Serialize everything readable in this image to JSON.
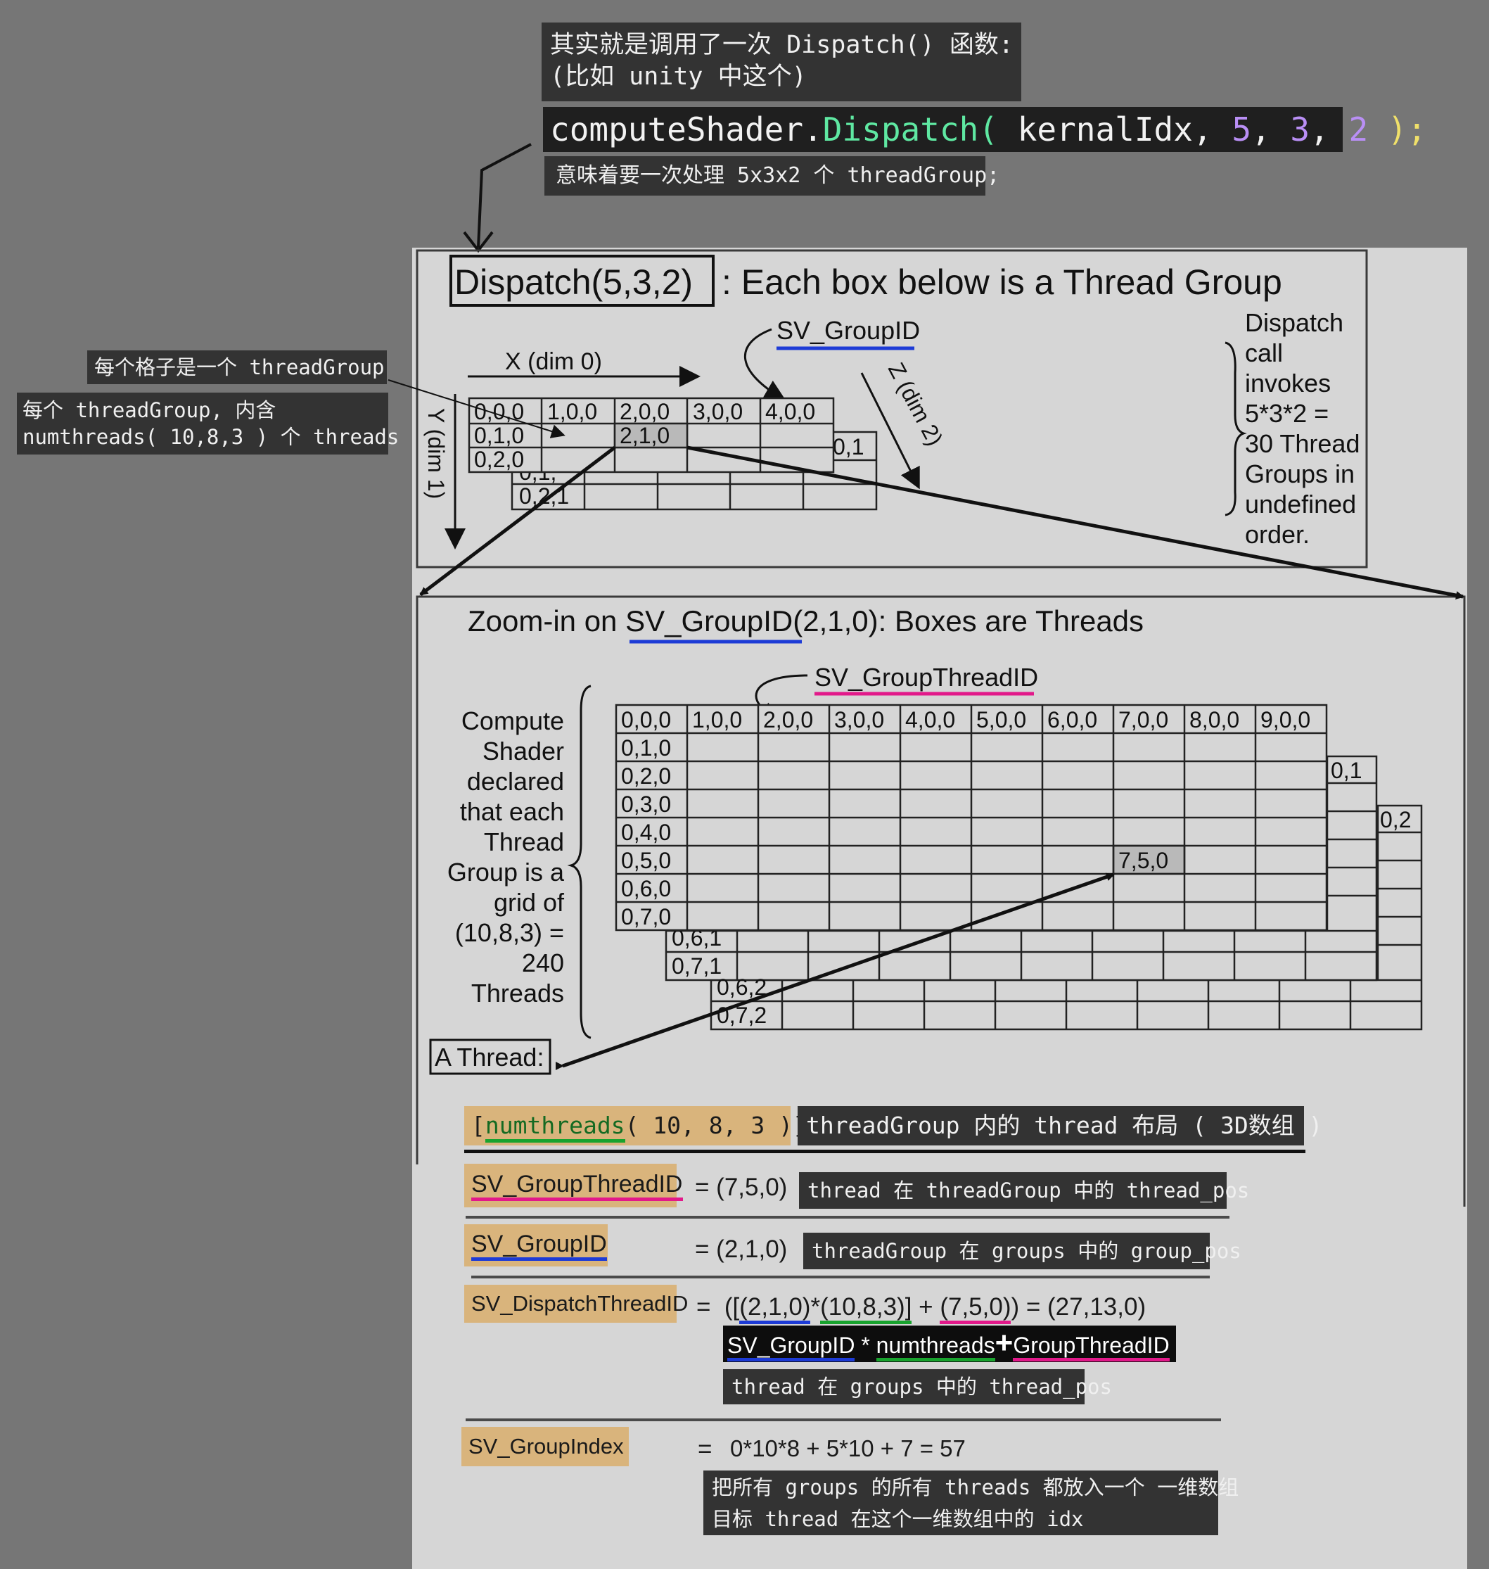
{
  "annotations": {
    "top_note": "其实就是调用了一次 Dispatch() 函数:\n(比如 unity 中这个)",
    "code": {
      "part1": "computeShader",
      "dot": ".",
      "func": "Dispatch(",
      "arg0": " kernalIdx,",
      "n1": " 5",
      "c1": ",",
      "n2": " 3",
      "c2": ",",
      "n3": " 2",
      "close": " );"
    },
    "code_meaning": "意味着要一次处理 5x3x2 个 threadGroup;",
    "grid_cell_note": "每个格子是一个 threadGroup",
    "group_note": "每个 threadGroup, 内含\nnumthreads( 10,8,3 ) 个 threads"
  },
  "diagram_top": {
    "title_box": "Dispatch(5,3,2)",
    "title_rest": ": Each box below is a Thread Group",
    "sv_groupid": "SV_GroupID",
    "x_label": "X (dim 0)",
    "y_label": "Y (dim 1)",
    "z_label": "Z (dim 2)",
    "row0": [
      "0,0,0",
      "1,0,0",
      "2,0,0",
      "3,0,0",
      "4,0,0"
    ],
    "col0": [
      "0,1,0",
      "0,2,0"
    ],
    "cell_210": "2,1,0",
    "layer1_a": "0,1,",
    "layer1_b": "0,2,1",
    "layer1_corner": "0,1",
    "side_text": [
      "Dispatch",
      "call",
      "invokes",
      "5*3*2 =",
      "30 Thread",
      "Groups in",
      "undefined",
      "order."
    ]
  },
  "diagram_zoom": {
    "title_pre": "Zoom-in on ",
    "title_id": "SV_GroupID",
    "title_post": "(2,1,0): Boxes are Threads",
    "sv_groupthreadid": "SV_GroupThreadID",
    "row0": [
      "0,0,0",
      "1,0,0",
      "2,0,0",
      "3,0,0",
      "4,0,0",
      "5,0,0",
      "6,0,0",
      "7,0,0",
      "8,0,0",
      "9,0,0"
    ],
    "col0": [
      "0,1,0",
      "0,2,0",
      "0,3,0",
      "0,4,0",
      "0,5,0",
      "0,6,0",
      "0,7,0"
    ],
    "cell_750": "7,5,0",
    "layer1": [
      "0,6,1",
      "0,7,1"
    ],
    "layer1_corner": "0,1",
    "layer2": [
      "0,6,2",
      "0,7,2"
    ],
    "layer2_corner": "0,2",
    "side_text": [
      "Compute",
      "Shader",
      "declared",
      "that each",
      "Thread",
      "Group is a",
      "grid of",
      "(10,8,3) =",
      "240",
      "Threads"
    ],
    "a_thread": "A Thread:"
  },
  "formulas": {
    "numthreads_open": "[",
    "numthreads_kw": "numthreads",
    "numthreads_args": "( 10, 8, 3 )]",
    "numthreads_note": "threadGroup 内的 thread 布局 ( 3D数组 )",
    "groupthreadid_tag": "SV_GroupThreadID",
    "groupthreadid_val": "= (7,5,0)",
    "groupthreadid_note": "thread 在 threadGroup 中的 thread_pos",
    "groupid_tag": "SV_GroupID",
    "groupid_val": "= (2,1,0)",
    "groupid_note": "threadGroup 在 groups 中的 group_pos",
    "dispatch_tag": "SV_DispatchThreadID",
    "dispatch_eq": "=",
    "dispatch_p1": "([",
    "dispatch_g": "(2,1,0)",
    "dispatch_star": "*",
    "dispatch_n": "(10,8,3)]",
    "dispatch_plus": " + ",
    "dispatch_t": "(7,5,0)",
    "dispatch_res": ") = (27,13,0)",
    "legend_gid": "SV_GroupID",
    "legend_star": " * ",
    "legend_num": "numthreads",
    "legend_plus": "+",
    "legend_gtid": "GroupThreadID",
    "dispatch_note": "thread 在 groups 中的 thread_pos",
    "index_tag": "SV_GroupIndex",
    "index_eq": "=",
    "index_val": "0*10*8 + 5*10 + 7 = 57",
    "index_note": "把所有 groups 的所有 threads 都放入一个 一维数组\n目标 thread 在这个一维数组中的 idx"
  },
  "colors": {
    "background": "#767676",
    "panel": "#d6d6d6",
    "tag": "#d9b47c",
    "blue": "#1d3bd6",
    "pink": "#e2198a",
    "green": "#18a32e"
  }
}
